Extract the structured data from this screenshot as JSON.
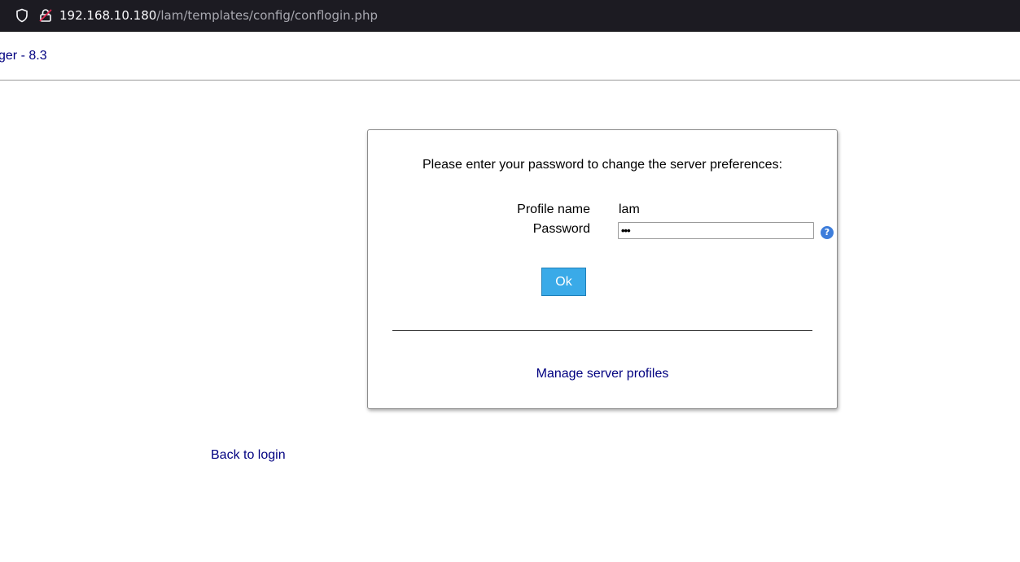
{
  "browser": {
    "url_host": "192.168.10.180",
    "url_path": "/lam/templates/config/conflogin.php",
    "icons": [
      "shield-icon",
      "insecure-lock-icon"
    ]
  },
  "header": {
    "app_title": "ger - 8.3"
  },
  "login_box": {
    "prompt": "Please enter your password to change the server preferences:",
    "profile_label": "Profile name",
    "profile_value": "lam",
    "password_label": "Password",
    "password_value": "•••",
    "help_icon": "?",
    "ok_label": "Ok",
    "manage_link": "Manage server profiles"
  },
  "footer": {
    "back_link": "Back to login"
  },
  "colors": {
    "link": "#000080",
    "ok_button": "#3aaae8",
    "help_icon": "#3d7ddb",
    "urlbar_bg": "#1c1b22"
  }
}
